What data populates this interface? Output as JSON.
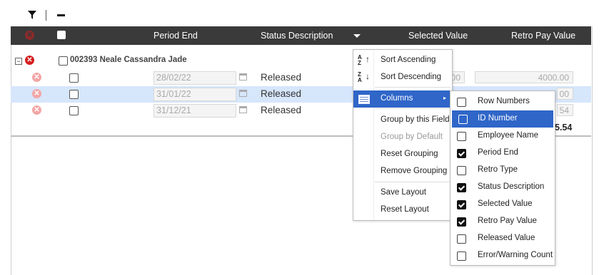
{
  "toolbar": {
    "filter_icon": "filter-icon",
    "collapse_icon": "minus-icon"
  },
  "header": {
    "columns": [
      "Period End",
      "Status Description",
      "Selected Value",
      "Retro Pay Value"
    ]
  },
  "group": {
    "label": "002393  Neale Cassandra Jade"
  },
  "rows": [
    {
      "period_end": "28/02/22",
      "status": "Released",
      "selected_value": "00",
      "retro_pay_value": "4000.00"
    },
    {
      "period_end": "31/01/22",
      "status": "Released",
      "selected_value": "",
      "retro_pay_value": "00"
    },
    {
      "period_end": "31/12/21",
      "status": "Released",
      "selected_value": "",
      "retro_pay_value": "54"
    }
  ],
  "total": "5.54",
  "menu": {
    "items": [
      "Sort Ascending",
      "Sort Descending",
      "Columns",
      "Group by this Field",
      "Group by Default",
      "Reset Grouping",
      "Remove Grouping",
      "Save Layout",
      "Reset Layout"
    ]
  },
  "submenu": {
    "items": [
      {
        "label": "Row Numbers",
        "checked": false
      },
      {
        "label": "ID Number",
        "checked": false
      },
      {
        "label": "Employee Name",
        "checked": false
      },
      {
        "label": "Period End",
        "checked": true
      },
      {
        "label": "Retro Type",
        "checked": false
      },
      {
        "label": "Status Description",
        "checked": true
      },
      {
        "label": "Selected Value",
        "checked": true
      },
      {
        "label": "Retro Pay Value",
        "checked": true
      },
      {
        "label": "Released Value",
        "checked": false
      },
      {
        "label": "Error/Warning Count",
        "checked": false
      }
    ]
  },
  "colors": {
    "header_bg": "#3a3a3a",
    "highlight": "#2f66c8",
    "selected_row": "#d6e6fb",
    "error_red": "#d41e1e"
  }
}
